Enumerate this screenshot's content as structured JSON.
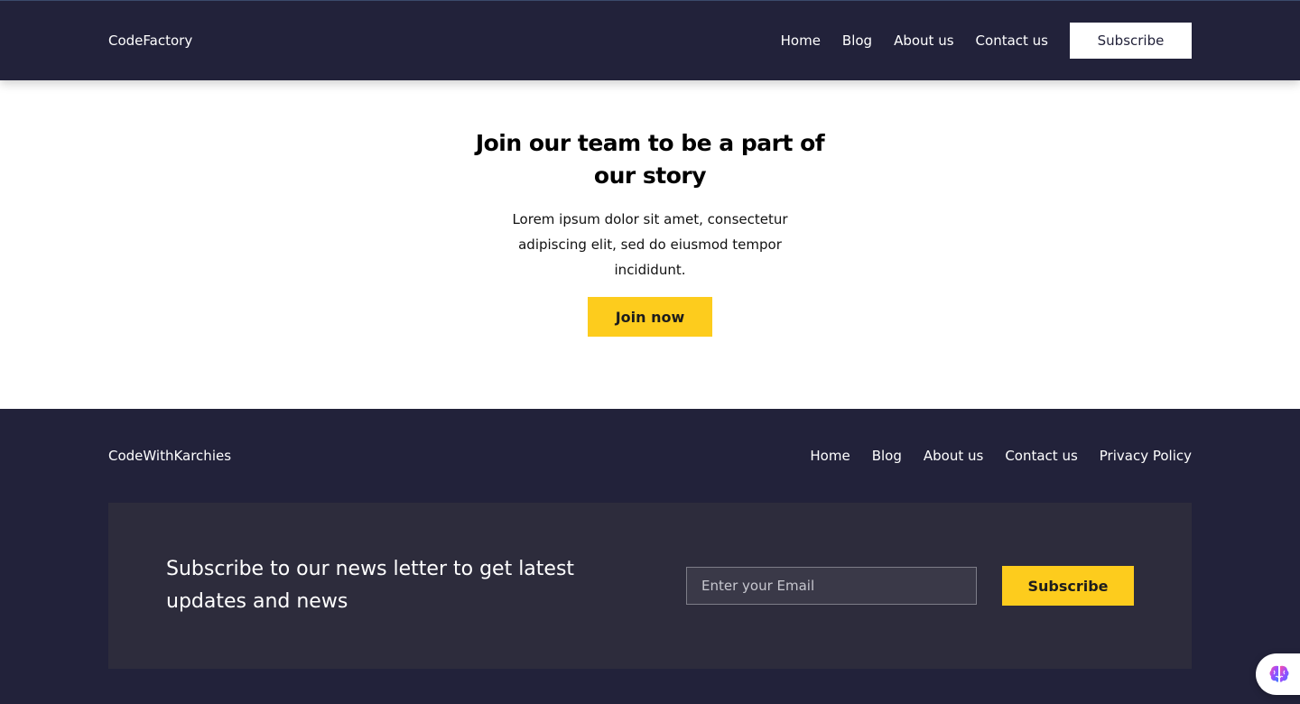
{
  "colors": {
    "header_bg": "#22223a",
    "footer_bg": "#22223a",
    "newsletter_bg": "#2d2c3c",
    "accent_yellow": "#fdcc1d",
    "text_white": "#ffffff"
  },
  "header": {
    "brand": "CodeFactory",
    "nav": [
      "Home",
      "Blog",
      "About us",
      "Contact us"
    ],
    "subscribe_label": "Subscribe"
  },
  "hero": {
    "title": "Join our team to be a part of our story",
    "text": "Lorem ipsum dolor sit amet, consectetur adipiscing elit, sed do eiusmod tempor incididunt.",
    "button_label": "Join now"
  },
  "footer": {
    "brand": "CodeWithKarchies",
    "nav": [
      "Home",
      "Blog",
      "About us",
      "Contact us",
      "Privacy Policy"
    ],
    "newsletter": {
      "text": "Subscribe to our news letter to get latest updates and news",
      "email_placeholder": "Enter your Email",
      "email_value": "",
      "button_label": "Subscribe"
    }
  },
  "widget": {
    "icon": "brain-icon"
  }
}
